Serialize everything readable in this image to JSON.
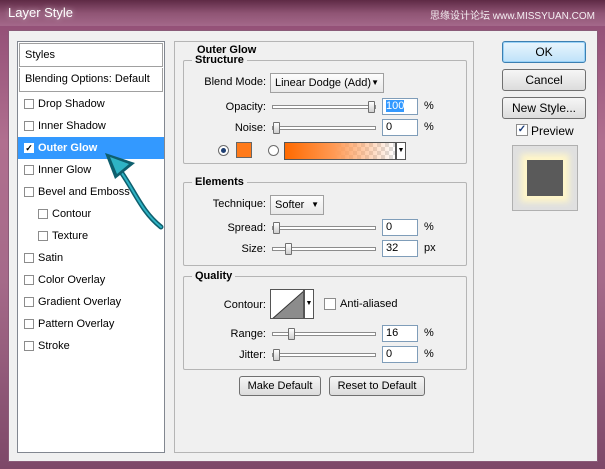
{
  "window": {
    "title": "Layer Style",
    "watermark": "思缘设计论坛 www.MISSYUAN.COM"
  },
  "styles_panel": {
    "header": "Styles",
    "blending": "Blending Options: Default",
    "items": [
      {
        "label": "Drop Shadow",
        "checked": false,
        "indent": false
      },
      {
        "label": "Inner Shadow",
        "checked": false,
        "indent": false
      },
      {
        "label": "Outer Glow",
        "checked": true,
        "indent": false,
        "selected": true
      },
      {
        "label": "Inner Glow",
        "checked": false,
        "indent": false
      },
      {
        "label": "Bevel and Emboss",
        "checked": false,
        "indent": false
      },
      {
        "label": "Contour",
        "checked": false,
        "indent": true
      },
      {
        "label": "Texture",
        "checked": false,
        "indent": true
      },
      {
        "label": "Satin",
        "checked": false,
        "indent": false
      },
      {
        "label": "Color Overlay",
        "checked": false,
        "indent": false
      },
      {
        "label": "Gradient Overlay",
        "checked": false,
        "indent": false
      },
      {
        "label": "Pattern Overlay",
        "checked": false,
        "indent": false
      },
      {
        "label": "Stroke",
        "checked": false,
        "indent": false
      }
    ]
  },
  "outer_glow": {
    "title": "Outer Glow",
    "structure": {
      "legend": "Structure",
      "blend_mode_label": "Blend Mode:",
      "blend_mode_value": "Linear Dodge (Add)",
      "opacity_label": "Opacity:",
      "opacity_value": "100",
      "opacity_unit": "%",
      "opacity_fraction": 1.0,
      "noise_label": "Noise:",
      "noise_value": "0",
      "noise_unit": "%",
      "noise_fraction": 0.0,
      "glow_color": "#ff7a1a"
    },
    "elements": {
      "legend": "Elements",
      "technique_label": "Technique:",
      "technique_value": "Softer",
      "spread_label": "Spread:",
      "spread_value": "0",
      "spread_unit": "%",
      "spread_fraction": 0.0,
      "size_label": "Size:",
      "size_value": "32",
      "size_unit": "px",
      "size_fraction": 0.13
    },
    "quality": {
      "legend": "Quality",
      "contour_label": "Contour:",
      "anti_aliased_label": "Anti-aliased",
      "anti_aliased": false,
      "range_label": "Range:",
      "range_value": "16",
      "range_unit": "%",
      "range_fraction": 0.16,
      "jitter_label": "Jitter:",
      "jitter_value": "0",
      "jitter_unit": "%",
      "jitter_fraction": 0.0
    },
    "make_default": "Make Default",
    "reset_default": "Reset to Default"
  },
  "buttons": {
    "ok": "OK",
    "cancel": "Cancel",
    "new_style": "New Style..."
  },
  "preview": {
    "label": "Preview",
    "checked": true
  }
}
